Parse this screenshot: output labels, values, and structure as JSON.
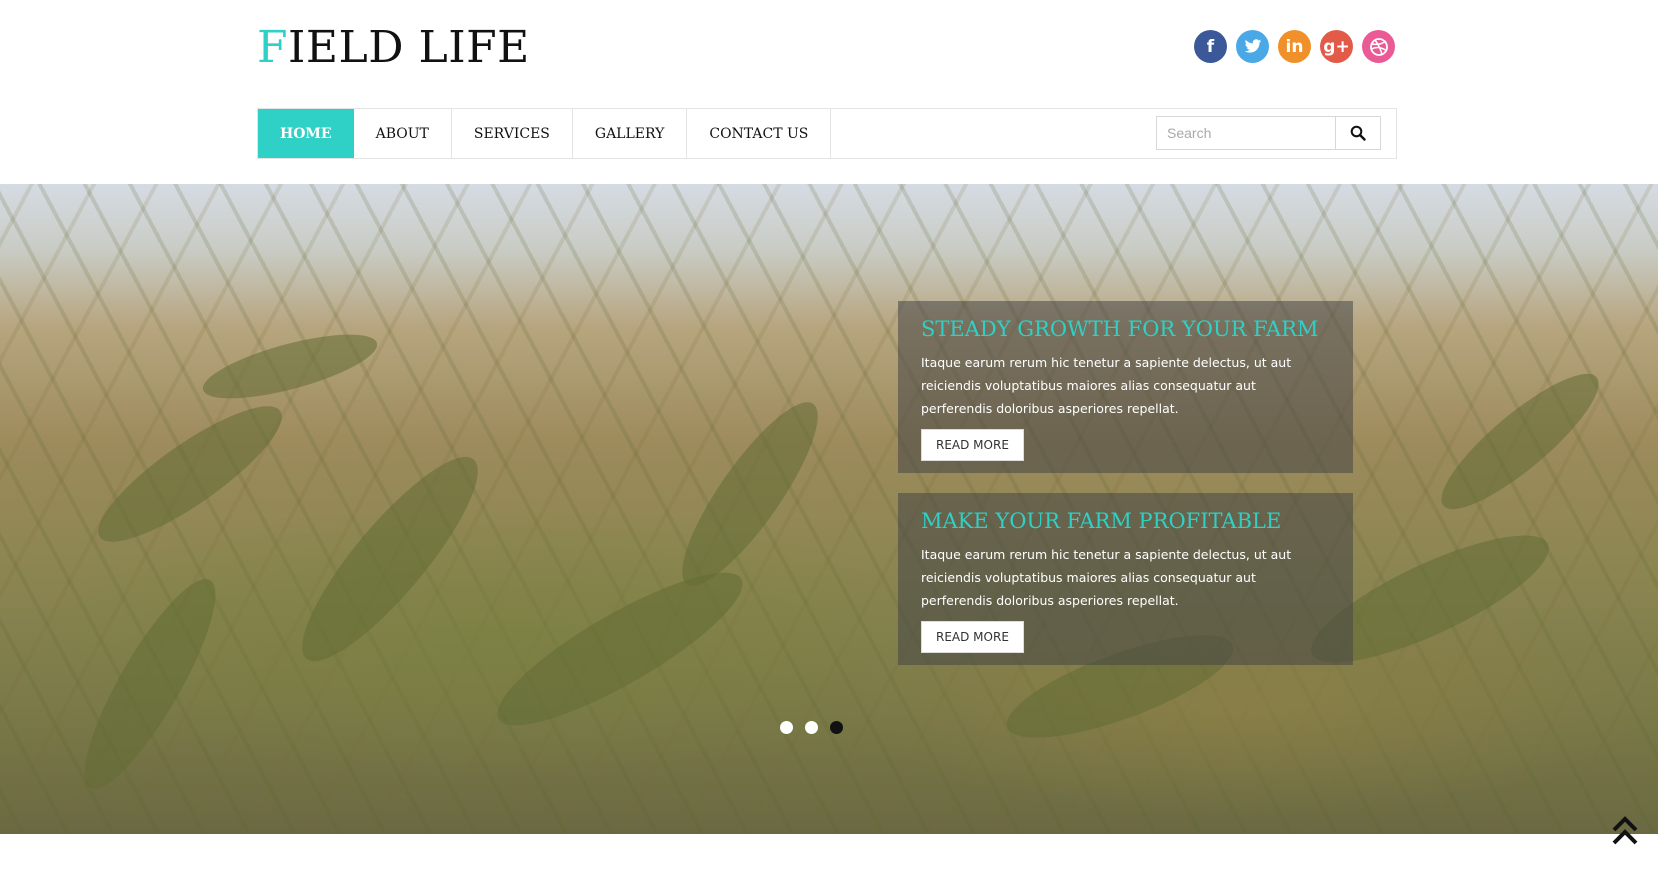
{
  "logo": {
    "first_letter": "F",
    "rest": "IELD LIFE"
  },
  "social": [
    {
      "name": "facebook-icon",
      "glyph": "f",
      "color": "#3b5998"
    },
    {
      "name": "twitter-icon",
      "glyph": "t",
      "color": "#4aa8e6"
    },
    {
      "name": "linkedin-icon",
      "glyph": "in",
      "color": "#f0902a"
    },
    {
      "name": "google-plus-icon",
      "glyph": "g+",
      "color": "#e15b48"
    },
    {
      "name": "dribbble-icon",
      "glyph": "◎",
      "color": "#ea5a94"
    }
  ],
  "nav": {
    "items": [
      "HOME",
      "ABOUT",
      "SERVICES",
      "GALLERY",
      "CONTACT US"
    ],
    "active": "HOME"
  },
  "search": {
    "placeholder": "Search"
  },
  "slides": [
    {
      "title": "STEADY GROWTH FOR YOUR FARM",
      "text": "Itaque earum rerum hic tenetur a sapiente delectus, ut aut reiciendis voluptatibus maiores alias consequatur aut perferendis doloribus asperiores repellat.",
      "button": "READ MORE"
    },
    {
      "title": "MAKE YOUR FARM PROFITABLE",
      "text": "Itaque earum rerum hic tenetur a sapiente delectus, ut aut reiciendis voluptatibus maiores alias consequatur aut perferendis doloribus asperiores repellat.",
      "button": "READ MORE"
    }
  ],
  "carousel": {
    "dot_count": 3,
    "active_index": 2
  },
  "colors": {
    "accent": "#2fd0c6"
  }
}
